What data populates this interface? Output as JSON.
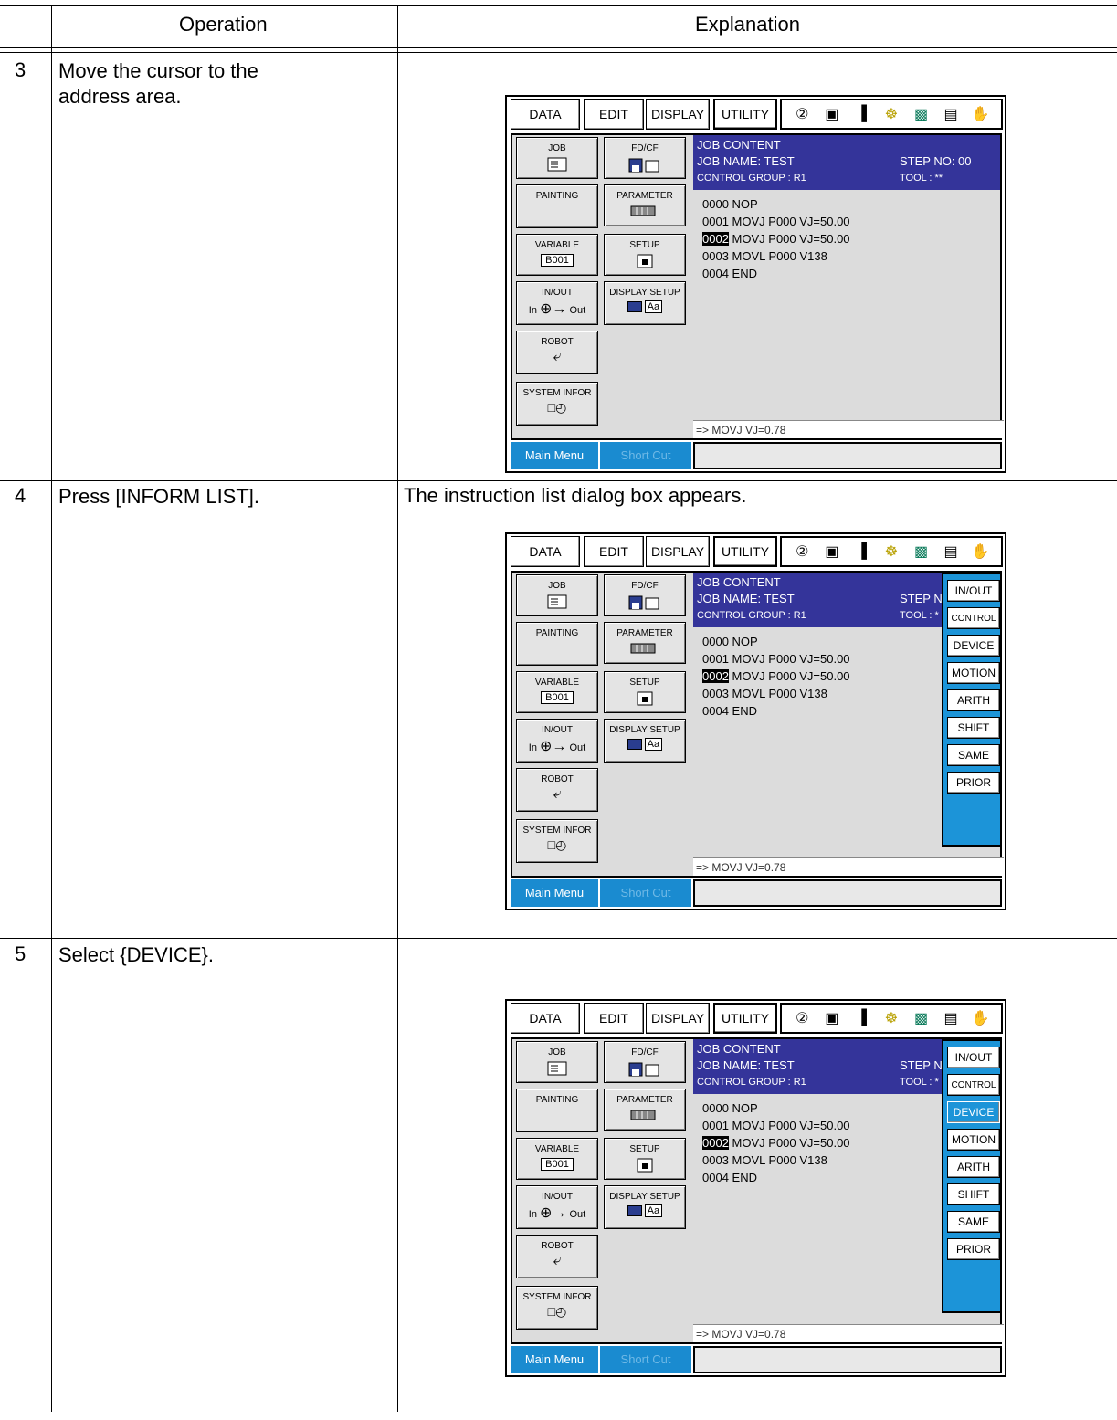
{
  "table": {
    "header": {
      "operation": "Operation",
      "explanation": "Explanation"
    },
    "rows": [
      {
        "step": "3",
        "operation": "Move the cursor to the address area.",
        "explanation": ""
      },
      {
        "step": "4",
        "operation": "Press [INFORM LIST].",
        "explanation": "The instruction list dialog box appears."
      },
      {
        "step": "5",
        "operation": "Select {DEVICE}.",
        "explanation": ""
      }
    ]
  },
  "screen": {
    "toolbar": [
      "DATA",
      "EDIT",
      "DISPLAY",
      "UTILITY"
    ],
    "icons": [
      "robot-arm-icon",
      "coordinate-icon",
      "manual-speed-icon",
      "key-icon",
      "display-icon",
      "cursor-icon",
      "hand-icon"
    ],
    "menu": {
      "job": "JOB",
      "fdcf": "FD/CF",
      "painting": "PAINTING",
      "parameter": "PARAMETER",
      "variable": "VARIABLE",
      "variable_value": "B001",
      "setup": "SETUP",
      "inout": "IN/OUT",
      "inout_in": "In",
      "inout_out": "Out",
      "display_setup": "DISPLAY SETUP",
      "display_setup_aa": "Aa",
      "robot": "ROBOT",
      "system_info": "SYSTEM INFOR"
    },
    "content": {
      "title": "JOB CONTENT",
      "job_name": "JOB NAME: TEST",
      "control_group": "CONTROL GROUP : R1",
      "step_no": "STEP NO: 00",
      "tool": "TOOL : **",
      "step_no_short": "STEP N",
      "tool_short": "TOOL : *",
      "lines": [
        {
          "addr": "0000",
          "text": "NOP"
        },
        {
          "addr": "0001",
          "text": "MOVJ P000 VJ=50.00"
        },
        {
          "addr": "0002",
          "text": "MOVJ P000 VJ=50.00"
        },
        {
          "addr": "0003",
          "text": "MOVL P000 V138"
        },
        {
          "addr": "0004",
          "text": "END"
        }
      ],
      "command": "=> MOVJ  VJ=0.78"
    },
    "bottom": {
      "main_menu": "Main Menu",
      "short_cut": "Short Cut"
    },
    "instruction_list": [
      "IN/OUT",
      "CONTROL",
      "DEVICE",
      "MOTION",
      "ARITH",
      "SHIFT",
      "SAME",
      "PRIOR"
    ]
  }
}
